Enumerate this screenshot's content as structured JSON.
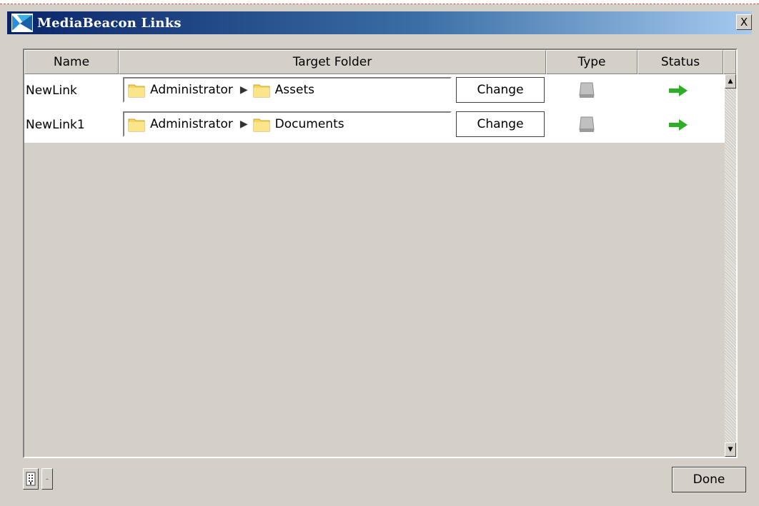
{
  "window": {
    "title": "MediaBeacon Links",
    "close_label": "X"
  },
  "columns": {
    "name": "Name",
    "target": "Target Folder",
    "type": "Type",
    "status": "Status"
  },
  "rows": [
    {
      "name": "NewLink",
      "path_root": "Administrator",
      "path_leaf": "Assets",
      "change_label": "Change",
      "type_icon": "drive-icon",
      "status_icon": "green-arrow-icon"
    },
    {
      "name": "NewLink1",
      "path_root": "Administrator",
      "path_leaf": "Documents",
      "change_label": "Change",
      "type_icon": "drive-icon",
      "status_icon": "green-arrow-icon"
    }
  ],
  "footer": {
    "done_label": "Done",
    "remove_label": "-"
  },
  "colors": {
    "status_green": "#2eae28",
    "folder_yellow": "#f5d55a",
    "title_blue": "#0a246a"
  }
}
